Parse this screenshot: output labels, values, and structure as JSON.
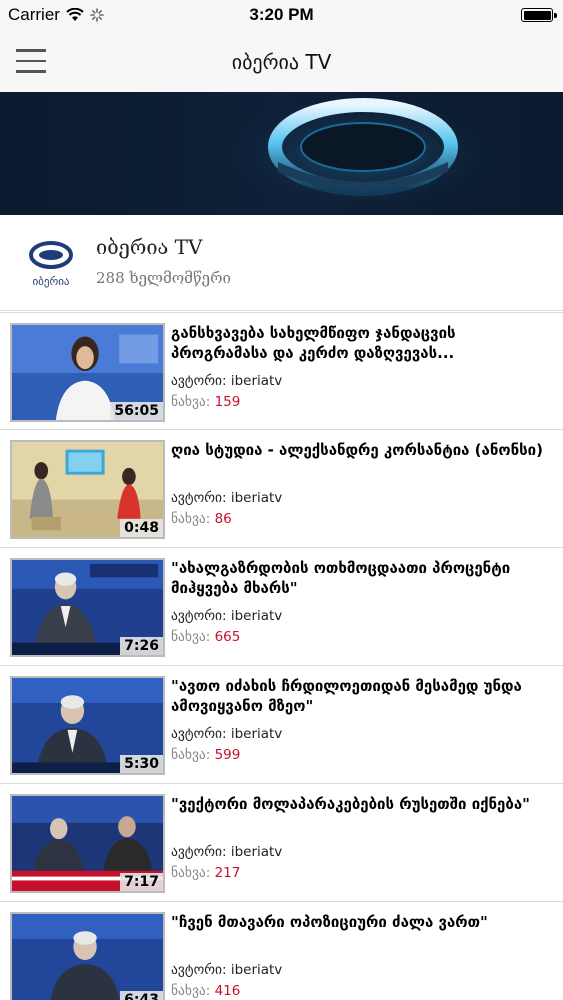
{
  "status_bar": {
    "carrier": "Carrier",
    "time": "3:20 PM"
  },
  "nav": {
    "title": "იბერია TV"
  },
  "channel": {
    "logo_text": "იბერია",
    "name": "იბერია TV",
    "subscribers": "288 ხელმომწერი"
  },
  "labels": {
    "author": "ავტორი:",
    "views": "ნახვა:"
  },
  "videos": [
    {
      "title": "განსხვავება სახელმწიფო ჯანდაცვის პროგრამასა და კერძო დაზღვევას...",
      "author": "iberiatv",
      "views": "159",
      "duration": "56:05"
    },
    {
      "title": "ღია სტუდია - ალექსანდრე კორსანტია (ანონსი)",
      "author": "iberiatv",
      "views": "86",
      "duration": "0:48"
    },
    {
      "title": "\"ახალგაზრდობის ოთხმოცდაათი პროცენტი მიჰყვება მხარს\"",
      "author": "iberiatv",
      "views": "665",
      "duration": "7:26"
    },
    {
      "title": "\"ავთო იძახის ჩრდილოეთიდან მესამედ უნდა ამოვიყვანო მზეო\"",
      "author": "iberiatv",
      "views": "599",
      "duration": "5:30"
    },
    {
      "title": "\"ვექტორი მოლაპარაკებების რუსეთში იქნება\"",
      "author": "iberiatv",
      "views": "217",
      "duration": "7:17"
    },
    {
      "title": "\"ჩვენ მთავარი ოპოზიციური ძალა ვართ\"",
      "author": "iberiatv",
      "views": "416",
      "duration": "6:43"
    }
  ]
}
